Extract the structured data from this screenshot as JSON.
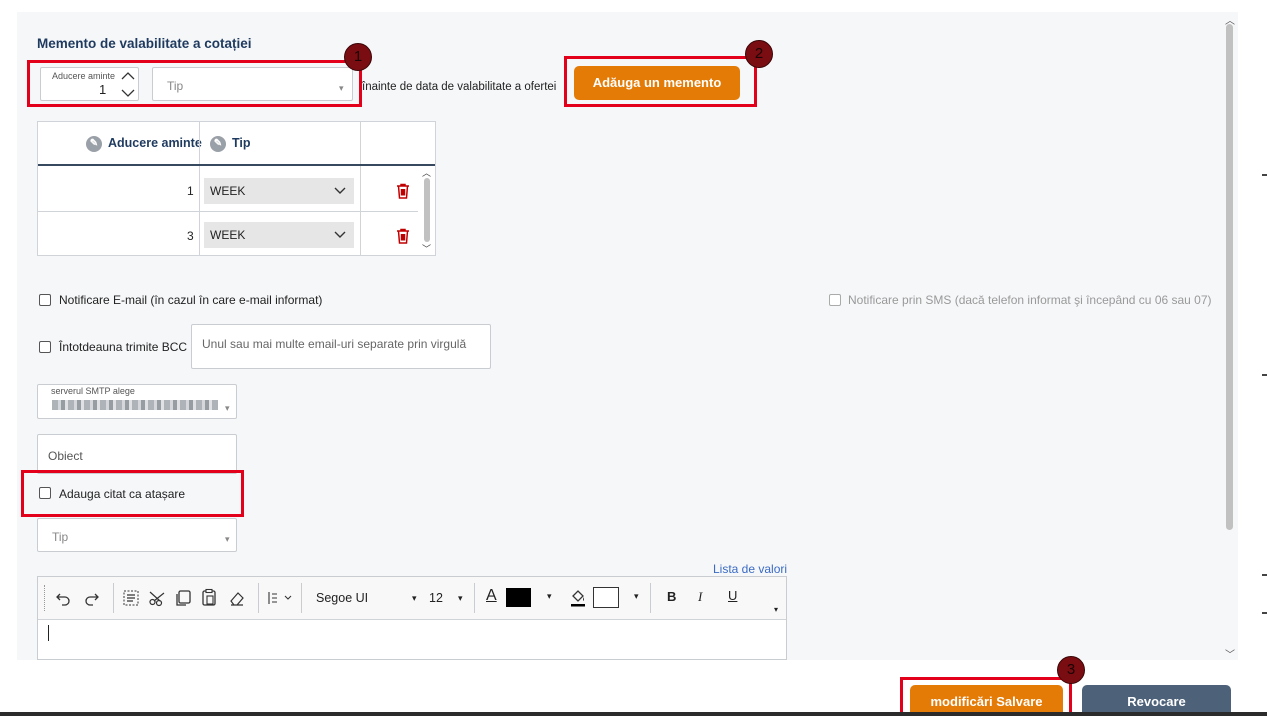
{
  "section": {
    "title": "Memento de valabilitate a cotației"
  },
  "reminder_form": {
    "stepper_label": "Aducere aminte",
    "stepper_value": "1",
    "type_placeholder": "Tip",
    "suffix_text": "înainte de data de valabilitate a ofertei",
    "add_button": "Adăuga un memento"
  },
  "badges": [
    "1",
    "2",
    "3"
  ],
  "reminders_table": {
    "columns": [
      "Aducere aminte",
      "Tip"
    ],
    "rows": [
      {
        "value": "1",
        "type": "WEEK"
      },
      {
        "value": "3",
        "type": "WEEK"
      }
    ]
  },
  "email_notification": {
    "label": "Notificare E-mail (în cazul în care e-mail informat)",
    "checked": false
  },
  "sms_notification": {
    "label": "Notificare prin SMS (dacă telefon informat şi începând cu 06 sau 07)",
    "checked": false,
    "disabled": true
  },
  "bcc": {
    "label": "Întotdeauna trimite BCC",
    "placeholder": "Unul sau mai multe email-uri separate prin virgulă"
  },
  "smtp": {
    "label": "serverul SMTP alege",
    "value_redacted": true
  },
  "subject": {
    "placeholder": "Obiect"
  },
  "attach_quote": {
    "label": "Adauga citat ca atașare",
    "checked": false
  },
  "template_type": {
    "placeholder": "Tip"
  },
  "value_list_link": "Lista de valori",
  "editor_toolbar": {
    "font_family": "Segoe UI",
    "font_size": "12",
    "text_color": "#000000",
    "highlight_color": "#ffffff",
    "bold": "B",
    "italic": "I",
    "underline": "U",
    "font_color_letter": "A"
  },
  "footer": {
    "save_button": "modificări Salvare",
    "cancel_button": "Revocare"
  },
  "colors": {
    "accent_orange": "#e47b07",
    "secondary_button": "#4d6179",
    "highlight_red": "#e3001b",
    "badge": "#7a0d12",
    "title_blue": "#1f3a5f",
    "trash_red": "#c00000"
  }
}
